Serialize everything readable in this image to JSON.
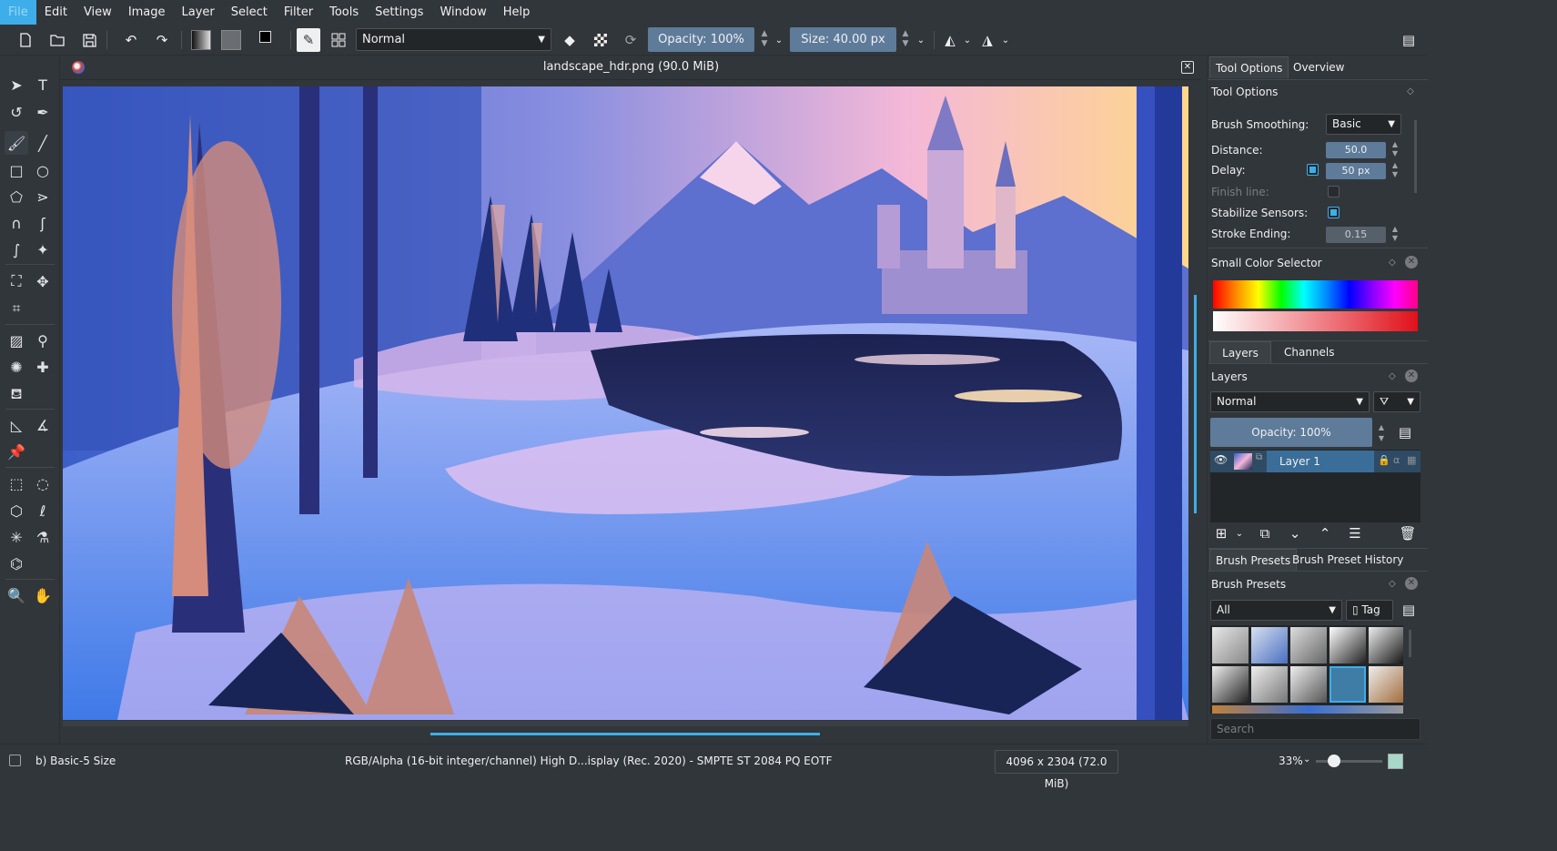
{
  "menubar": {
    "items": [
      "File",
      "Edit",
      "View",
      "Image",
      "Layer",
      "Select",
      "Filter",
      "Tools",
      "Settings",
      "Window",
      "Help"
    ]
  },
  "toolbar": {
    "blend_mode": "Normal",
    "opacity_label": "Opacity:  100%",
    "size_label": "Size:  40.00 px"
  },
  "canvas": {
    "title": "landscape_hdr.png (90.0 MiB)"
  },
  "dock": {
    "tool_options_tabs": [
      "Tool Options",
      "Overview"
    ],
    "tool_options": {
      "title": "Tool Options",
      "brush_smoothing_label": "Brush Smoothing:",
      "brush_smoothing_value": "Basic",
      "distance_label": "Distance:",
      "distance_value": "50.0",
      "delay_label": "Delay:",
      "delay_value": "50 px",
      "delay_checked": true,
      "finish_line_label": "Finish line:",
      "finish_line_checked": false,
      "stabilize_sensors_label": "Stabilize Sensors:",
      "stabilize_sensors_checked": true,
      "stroke_ending_label": "Stroke Ending:",
      "stroke_ending_value": "0.15"
    },
    "color_selector": {
      "title": "Small Color Selector"
    },
    "layers_tabs": [
      "Layers",
      "Channels"
    ],
    "layers": {
      "title": "Layers",
      "blend_mode": "Normal",
      "opacity_label": "Opacity:  100%",
      "items": [
        {
          "name": "Layer 1",
          "visible": true
        }
      ]
    },
    "brush_tabs": [
      "Brush Presets",
      "Brush Preset History"
    ],
    "brush_presets": {
      "title": "Brush Presets",
      "filter_value": "All",
      "tag_label": "Tag",
      "search_placeholder": "Search"
    }
  },
  "statusbar": {
    "brush_name": "b) Basic-5 Size",
    "color_profile": "RGB/Alpha (16-bit integer/channel)  High D...isplay (Rec. 2020) - SMPTE ST 2084 PQ EOTF",
    "image_size": "4096 x 2304 (72.0 MiB)",
    "zoom": "33%"
  },
  "colors": {
    "accent": "#3daee9",
    "window_bg": "#31363b",
    "field_blue": "#5e7b9a"
  }
}
